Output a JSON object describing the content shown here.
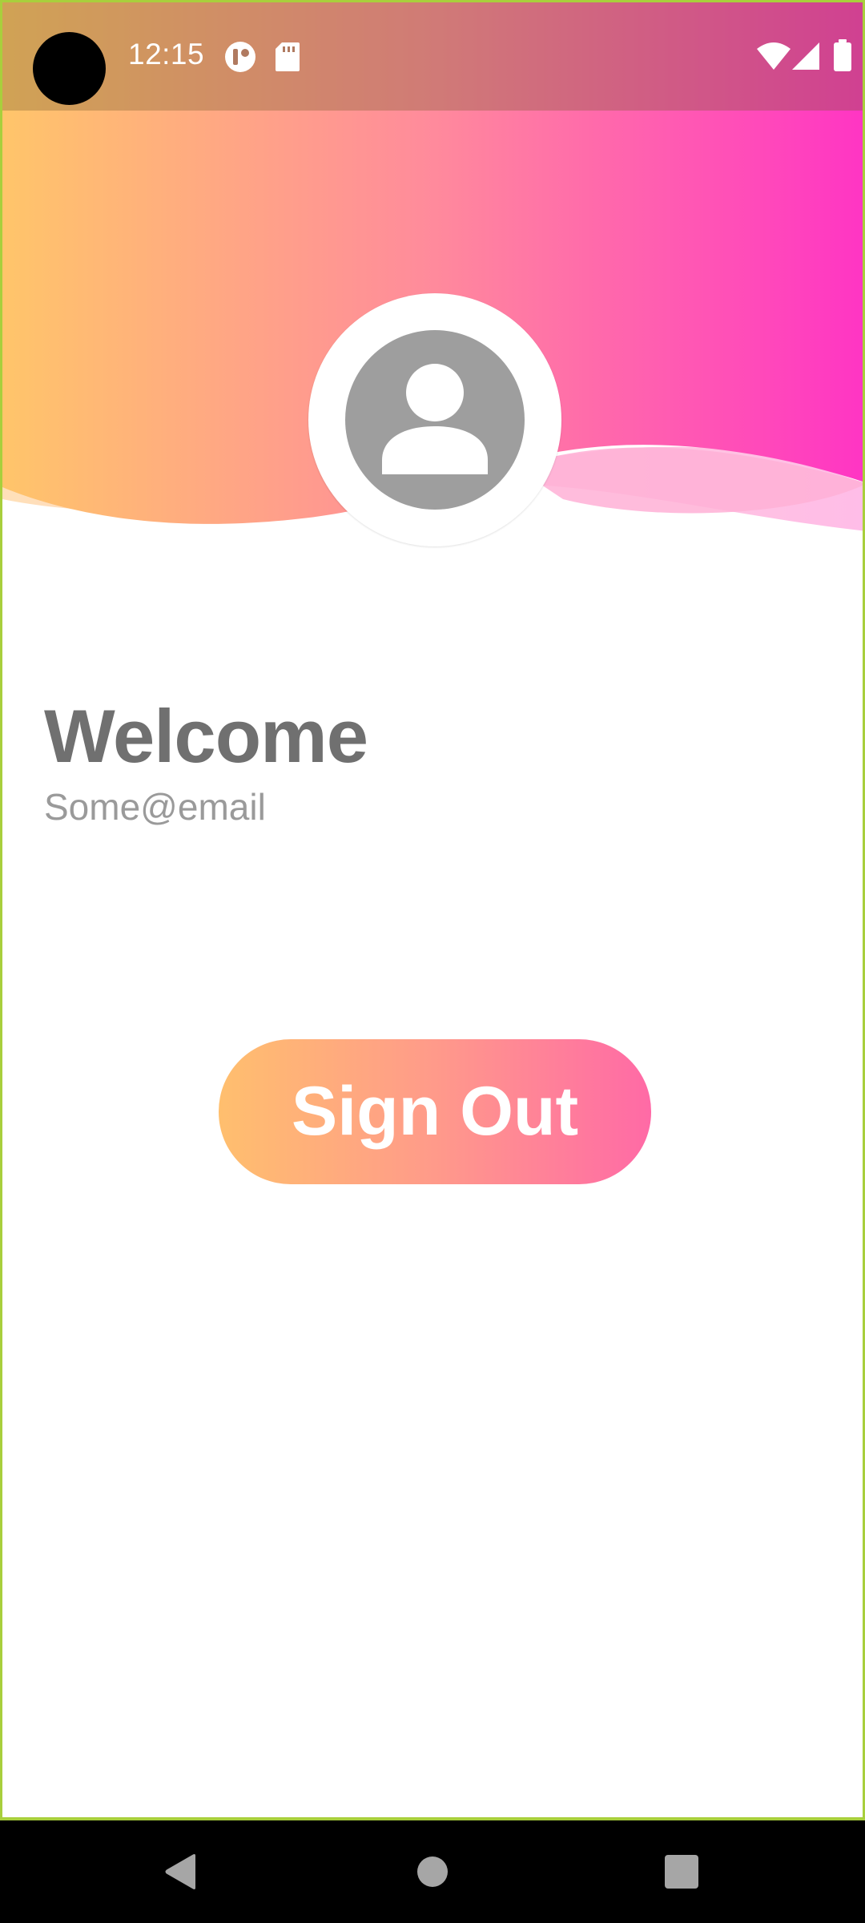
{
  "status_bar": {
    "time": "12:15",
    "left_icons": [
      "camera-cutout",
      "app-notification-icon",
      "sd-card-icon"
    ],
    "right_icons": [
      "wifi-icon",
      "cell-signal-icon",
      "battery-icon"
    ]
  },
  "header": {
    "gradient": [
      "#ffc56a",
      "#ff84a0",
      "#ff3cc6"
    ],
    "avatar_icon": "account-circle-icon"
  },
  "profile": {
    "greeting": "Welcome",
    "email": "Some@email"
  },
  "actions": {
    "sign_out_label": "Sign Out"
  },
  "navigation_bar": {
    "buttons": [
      "back",
      "home",
      "recents"
    ]
  },
  "colors": {
    "accent_start": "#ffbf6e",
    "accent_end": "#ff6aa6",
    "text_primary": "#707070",
    "text_secondary": "#9a9a9a"
  }
}
